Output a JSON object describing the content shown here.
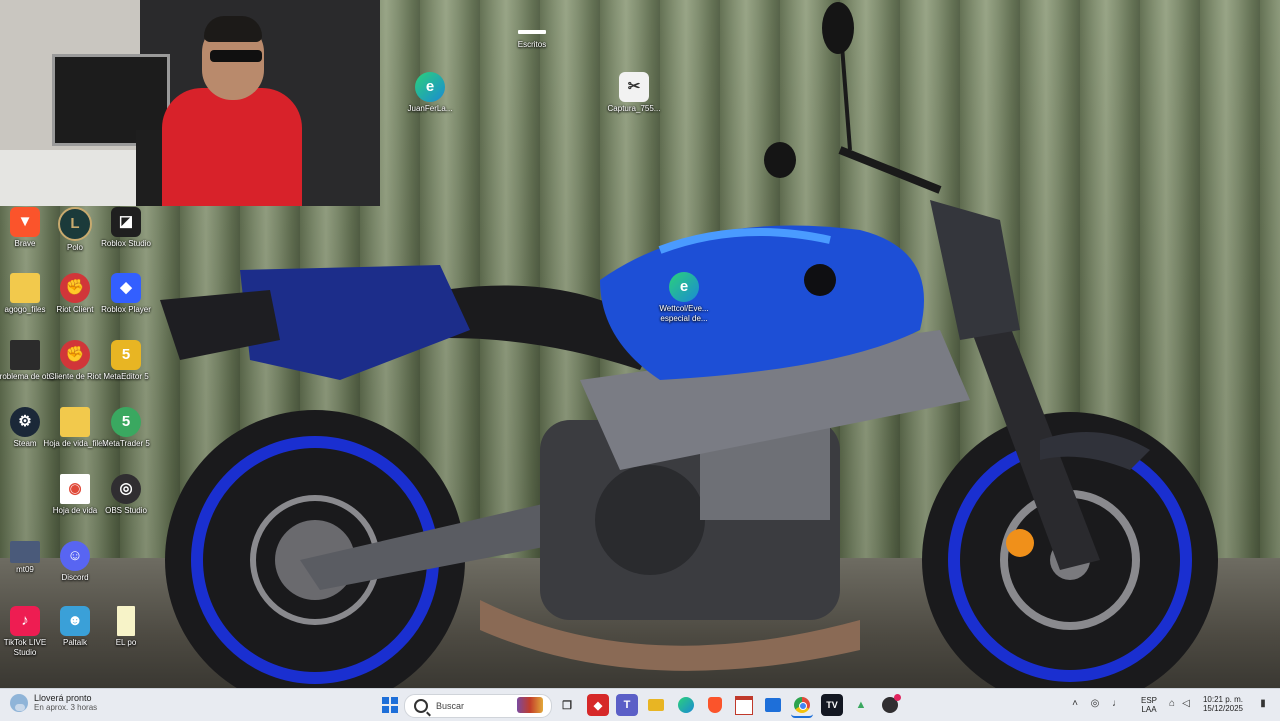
{
  "desktop": {
    "icons": [
      {
        "name": "desktop-icon-escritos",
        "label": "Escritos",
        "glyph": "",
        "color": "transparent"
      },
      {
        "name": "desktop-icon-juanferla",
        "label": "JuanFerLa...",
        "glyph": "e",
        "color": "#1a8ad4"
      },
      {
        "name": "desktop-icon-captura",
        "label": "Captura_755...",
        "glyph": "✂",
        "color": "#f2f2f2"
      },
      {
        "name": "desktop-icon-brave",
        "label": "Brave",
        "glyph": "🦁",
        "color": "#fb542b"
      },
      {
        "name": "desktop-icon-polo",
        "label": "Polo",
        "glyph": "L",
        "color": "#1b3a3a"
      },
      {
        "name": "desktop-icon-roblox-studio",
        "label": "Roblox Studio",
        "glyph": "◪",
        "color": "#1f1f1f"
      },
      {
        "name": "desktop-icon-agogo-files",
        "label": "agogo_files",
        "glyph": "",
        "color": "#f2c94c"
      },
      {
        "name": "desktop-icon-riot-client",
        "label": "Riot Client",
        "glyph": "✊",
        "color": "#d13639"
      },
      {
        "name": "desktop-icon-roblox-player",
        "label": "Roblox Player",
        "glyph": "◆",
        "color": "#335fff"
      },
      {
        "name": "desktop-icon-problema-de-obs",
        "label": "problema de obs",
        "glyph": "",
        "color": "#2b2b2b"
      },
      {
        "name": "desktop-icon-cliente-de-riot",
        "label": "Cliente de Riot",
        "glyph": "✊",
        "color": "#d13639"
      },
      {
        "name": "desktop-icon-metaeditor",
        "label": "MetaEditor 5",
        "glyph": "5",
        "color": "#e8b523"
      },
      {
        "name": "desktop-icon-steam",
        "label": "Steam",
        "glyph": "⚙",
        "color": "#1b2838"
      },
      {
        "name": "desktop-icon-hoja-de-vida-files",
        "label": "Hoja de vida_files",
        "glyph": "",
        "color": "#f2c94c"
      },
      {
        "name": "desktop-icon-metatrader",
        "label": "MetaTrader 5",
        "glyph": "5",
        "color": "#3aa860"
      },
      {
        "name": "desktop-icon-hoja-de-vida",
        "label": "Hoja de vida",
        "glyph": "◉",
        "color": "#ffffff"
      },
      {
        "name": "desktop-icon-obs-studio",
        "label": "OBS Studio",
        "glyph": "◎",
        "color": "#302e31"
      },
      {
        "name": "desktop-icon-mt09",
        "label": "mt09",
        "glyph": "",
        "color": "#4a5a7a"
      },
      {
        "name": "desktop-icon-discord",
        "label": "Discord",
        "glyph": "☺",
        "color": "#5865f2"
      },
      {
        "name": "desktop-icon-tiktok-live-studio",
        "label": "TikTok LIVE Studio",
        "glyph": "♪",
        "color": "#ee1d52"
      },
      {
        "name": "desktop-icon-paltalk",
        "label": "Paltalk",
        "glyph": "☻",
        "color": "#3aa0d8"
      },
      {
        "name": "desktop-icon-el-po",
        "label": "EL po",
        "glyph": "",
        "color": "#f7f3c8"
      },
      {
        "name": "desktop-icon-wetcol",
        "label": "Wettcol/Eve... especial de...",
        "glyph": "e",
        "color": "#1a8ad4"
      }
    ]
  },
  "taskbar": {
    "weather_line1": "Lloverá pronto",
    "weather_line2": "En aprox. 3 horas",
    "search_placeholder": "Buscar",
    "apps": [
      {
        "name": "taskbar-start-button",
        "glyph": "⊞",
        "color": "#1e6fd9",
        "bg": "transparent"
      },
      {
        "name": "taskbar-task-view",
        "glyph": "▭",
        "color": "#333",
        "bg": "transparent"
      },
      {
        "name": "taskbar-app-red",
        "glyph": "◆",
        "color": "#fff",
        "bg": "#d62828"
      },
      {
        "name": "taskbar-app-teams",
        "glyph": "T",
        "color": "#fff",
        "bg": "#5b5fc7"
      },
      {
        "name": "taskbar-file-explorer",
        "glyph": "▬",
        "color": "#e8b523",
        "bg": "transparent"
      },
      {
        "name": "taskbar-edge",
        "glyph": "e",
        "color": "#1a8ad4",
        "bg": "transparent"
      },
      {
        "name": "taskbar-brave",
        "glyph": "◈",
        "color": "#fb542b",
        "bg": "transparent"
      },
      {
        "name": "taskbar-app-calendar",
        "glyph": "▤",
        "color": "#c0392b",
        "bg": "transparent"
      },
      {
        "name": "taskbar-store",
        "glyph": "▦",
        "color": "#1e6fd9",
        "bg": "transparent"
      },
      {
        "name": "taskbar-chrome",
        "glyph": "◉",
        "color": "#e04a3a",
        "bg": "transparent"
      },
      {
        "name": "taskbar-tradingview",
        "glyph": "TV",
        "color": "#fff",
        "bg": "#131722"
      },
      {
        "name": "taskbar-metatrader",
        "glyph": "▲",
        "color": "#3aa860",
        "bg": "transparent"
      },
      {
        "name": "taskbar-obs",
        "glyph": "◎",
        "color": "#302e31",
        "bg": "transparent"
      }
    ],
    "tray": {
      "language_line1": "ESP",
      "language_line2": "LAA",
      "time": "10:21 p. m.",
      "date": "15/12/2025"
    }
  }
}
